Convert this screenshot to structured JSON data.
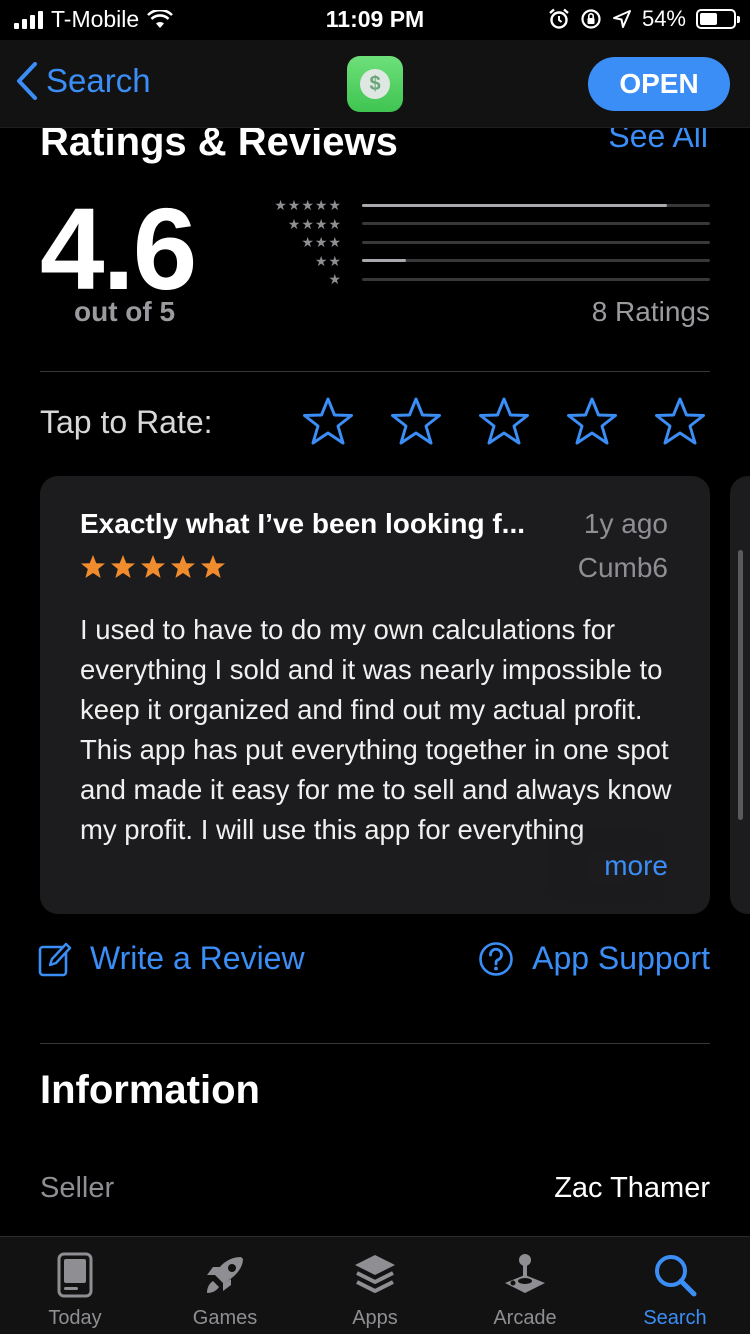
{
  "status_bar": {
    "carrier": "T-Mobile",
    "time": "11:09 PM",
    "battery": "54%",
    "battery_level": 0.54
  },
  "nav": {
    "back_label": "Search",
    "app_icon": "dollar-icon",
    "open_label": "OPEN"
  },
  "ratings": {
    "title": "Ratings & Reviews",
    "see_all": "See All",
    "average": "4.6",
    "out_of": "out of 5",
    "count": "8 Ratings",
    "histogram": [
      {
        "stars": 5,
        "fraction": 0.875
      },
      {
        "stars": 4,
        "fraction": 0.0
      },
      {
        "stars": 3,
        "fraction": 0.0
      },
      {
        "stars": 2,
        "fraction": 0.125
      },
      {
        "stars": 1,
        "fraction": 0.0
      }
    ]
  },
  "tap_to_rate": {
    "label": "Tap to Rate:",
    "stars": 5
  },
  "review": {
    "title": "Exactly what I’ve been looking f...",
    "date": "1y ago",
    "author": "Cumb6",
    "rating": 5,
    "body": "I used to have to do my own calculations for everything I sold and it was nearly impossible to keep it organized and find out my actual profit. This app has put everything together in one spot and made it easy for me to sell and always know my profit. I will use this app for everything",
    "more_label": "more"
  },
  "actions": {
    "write_review": "Write a Review",
    "app_support": "App Support"
  },
  "information": {
    "title": "Information",
    "seller_label": "Seller",
    "seller_value": "Zac Thamer"
  },
  "tabs": [
    {
      "label": "Today",
      "icon": "today-icon",
      "active": false
    },
    {
      "label": "Games",
      "icon": "rocket-icon",
      "active": false
    },
    {
      "label": "Apps",
      "icon": "stack-icon",
      "active": false
    },
    {
      "label": "Arcade",
      "icon": "joystick-icon",
      "active": false
    },
    {
      "label": "Search",
      "icon": "search-icon",
      "active": true
    }
  ],
  "colors": {
    "accent": "#3b8ef6",
    "star_orange": "#f08c2e",
    "card": "#1c1c1e"
  }
}
